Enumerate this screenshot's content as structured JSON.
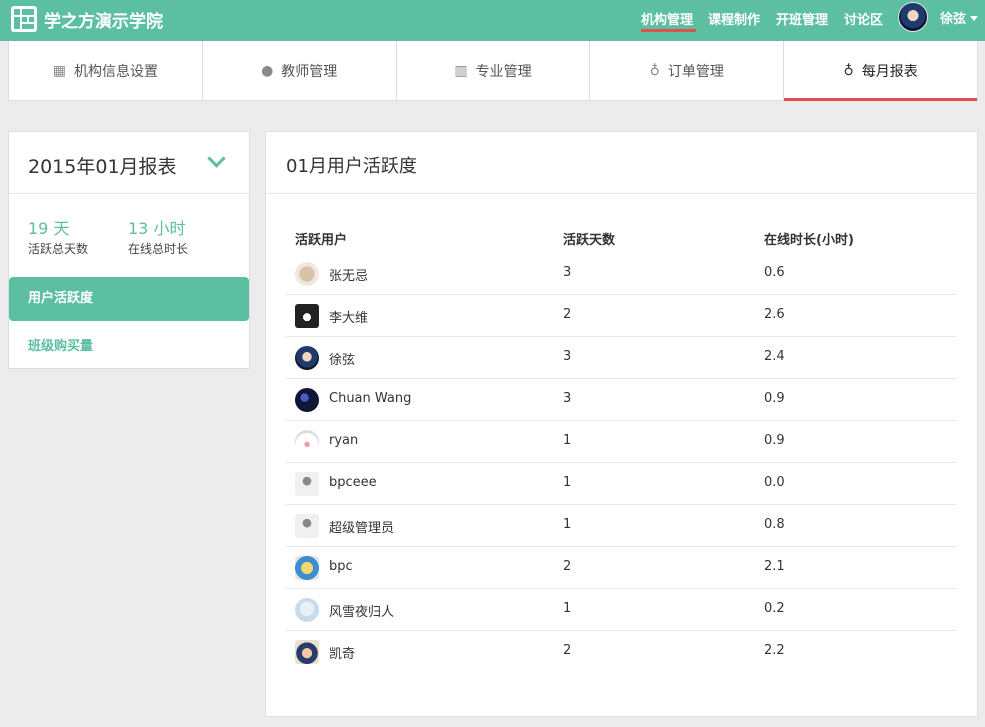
{
  "header": {
    "brand": "学之方演示学院",
    "nav": [
      "机构管理",
      "课程制作",
      "开班管理",
      "讨论区"
    ],
    "username": "徐弦",
    "accent_color": "#5cbfa1",
    "highlight_color": "#e0504d"
  },
  "tabs": [
    {
      "label": "机构信息设置",
      "icon": "building-icon"
    },
    {
      "label": "教师管理",
      "icon": "user-icon"
    },
    {
      "label": "专业管理",
      "icon": "books-icon"
    },
    {
      "label": "订单管理",
      "icon": "money-bag-icon"
    },
    {
      "label": "每月报表",
      "icon": "money-bag-icon"
    }
  ],
  "sidebar": {
    "title": "2015年01月报表",
    "stats": [
      {
        "value": "19 天",
        "label": "活跃总天数"
      },
      {
        "value": "13 小时",
        "label": "在线总时长"
      }
    ],
    "items": [
      {
        "label": "用户活跃度"
      },
      {
        "label": "班级购买量"
      }
    ]
  },
  "main": {
    "title": "01月用户活跃度",
    "columns": [
      "活跃用户",
      "活跃天数",
      "在线时长(小时)"
    ],
    "rows": [
      {
        "name": "张无忌",
        "days": "3",
        "hours": "0.6"
      },
      {
        "name": "李大维",
        "days": "2",
        "hours": "2.6"
      },
      {
        "name": "徐弦",
        "days": "3",
        "hours": "2.4"
      },
      {
        "name": "Chuan Wang",
        "days": "3",
        "hours": "0.9"
      },
      {
        "name": "ryan",
        "days": "1",
        "hours": "0.9"
      },
      {
        "name": "bpceee",
        "days": "1",
        "hours": "0.0"
      },
      {
        "name": "超级管理员",
        "days": "1",
        "hours": "0.8"
      },
      {
        "name": "bpc",
        "days": "2",
        "hours": "2.1"
      },
      {
        "name": "风雪夜归人",
        "days": "1",
        "hours": "0.2"
      },
      {
        "name": "凯奇",
        "days": "2",
        "hours": "2.2"
      }
    ]
  }
}
